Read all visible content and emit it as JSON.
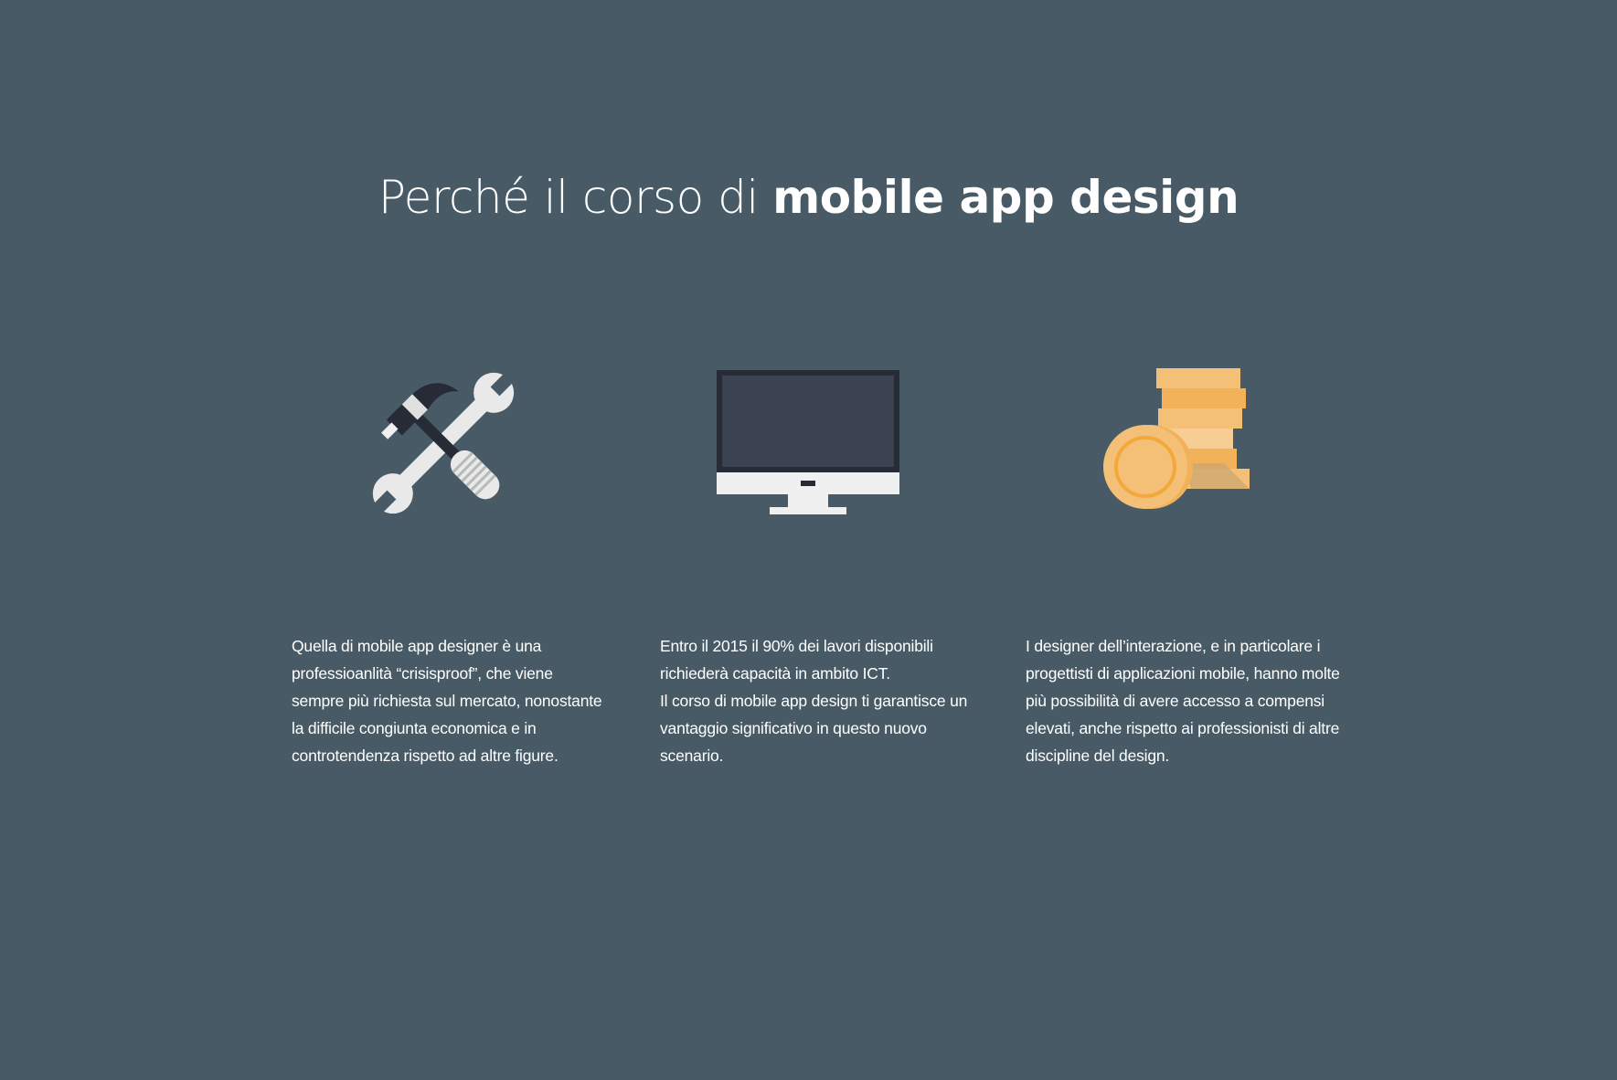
{
  "heading": {
    "light": "Perché il corso di ",
    "bold": "mobile app design"
  },
  "features": [
    {
      "icon": "tools-icon",
      "paragraphs": [
        "Quella di mobile app designer è una professioanlità “crisisproof”, che viene sempre più richiesta sul mercato, nonostante la difficile congiunta economica e in controtendenza rispetto ad altre figure."
      ]
    },
    {
      "icon": "monitor-icon",
      "paragraphs": [
        "Entro il 2015 il 90% dei lavori disponibili richiederà capacità in ambito ICT.",
        "Il corso di mobile app design ti garantisce un vantaggio significativo in questo nuovo scenario."
      ]
    },
    {
      "icon": "coins-icon",
      "paragraphs": [
        "I designer dell’interazione, e in particolare i progettisti di applicazioni mobile, hanno molte più possibilità di avere accesso a compensi elevati, anche rispetto ai professionisti di altre discipline del design."
      ]
    }
  ],
  "colors": {
    "background": "#475a66",
    "text": "#ffffff",
    "coin": "#f4c078",
    "coin_dark": "#f2b25a",
    "monitor_screen": "#3b4252",
    "monitor_frame": "#262b36",
    "tool_light": "#f0f0f0",
    "tool_dark": "#262b36"
  }
}
